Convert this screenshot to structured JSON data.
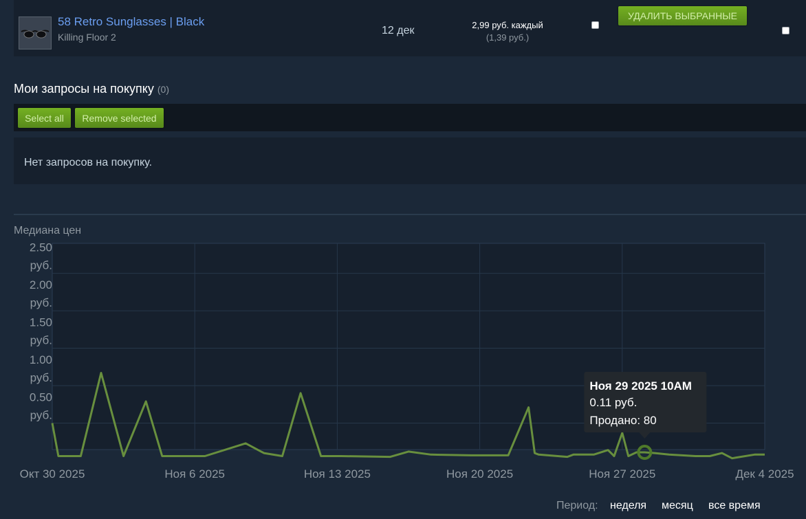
{
  "listing": {
    "item_name": "58 Retro Sunglasses | Black",
    "game": "Killing Floor 2",
    "date": "12 дек",
    "price": "2,99 руб. каждый",
    "price_sub": "(1,39 руб.)"
  },
  "buttons": {
    "remove_selected_ru": "УДАЛИТЬ ВЫБРАННЫЕ",
    "select_all": "Select all",
    "remove_selected": "Remove selected"
  },
  "buy_orders": {
    "title": "Мои запросы на покупку",
    "count": "(0)",
    "empty_text": "Нет запросов на покупку."
  },
  "colors": {
    "line": "#688f3e",
    "background": "#1b2838",
    "plot_background": "#16202d",
    "link": "#6b9ef0"
  },
  "chart_data": {
    "type": "line",
    "title": "Медиана цен",
    "ylim": [
      0,
      2.9
    ],
    "y_ticks": [
      {
        "value": 2.5,
        "line1": "2.50",
        "line2": "руб."
      },
      {
        "value": 2.0,
        "line1": "2.00",
        "line2": "руб."
      },
      {
        "value": 1.5,
        "line1": "1.50",
        "line2": "руб."
      },
      {
        "value": 1.0,
        "line1": "1.00",
        "line2": "руб."
      },
      {
        "value": 0.5,
        "line1": "0.50",
        "line2": "руб."
      }
    ],
    "x_ticks": [
      {
        "day": 0,
        "label": "Окт 30 2025"
      },
      {
        "day": 7,
        "label": "Ноя 6 2025"
      },
      {
        "day": 14,
        "label": "Ноя 13 2025"
      },
      {
        "day": 21,
        "label": "Ноя 20 2025"
      },
      {
        "day": 28,
        "label": "Ноя 27 2025"
      },
      {
        "day": 35,
        "label": "Дек 4 2025"
      }
    ],
    "grid": true,
    "series": [
      {
        "x": [
          0,
          0.3,
          1.4,
          2.4,
          3.5,
          4.6,
          5.4,
          6.2,
          7.5,
          9.5,
          10.4,
          11.3,
          12.2,
          13.2,
          14.2,
          16.6,
          17.5,
          18.6,
          20.6,
          21.3,
          22.4,
          23.4,
          23.7,
          23.9,
          25.3,
          25.6,
          26.6,
          27.3,
          27.6,
          28.0,
          28.3,
          28.7,
          29.1,
          29.6,
          30.3,
          31.6,
          32.3,
          32.9,
          33.4,
          33.6,
          34.5,
          34.8,
          35.0
        ],
        "y": [
          0.5,
          0.06,
          0.06,
          1.17,
          0.06,
          0.79,
          0.06,
          0.06,
          0.06,
          0.23,
          0.1,
          0.06,
          0.9,
          0.06,
          0.06,
          0.05,
          0.12,
          0.08,
          0.07,
          0.07,
          0.07,
          0.71,
          0.1,
          0.08,
          0.05,
          0.08,
          0.08,
          0.14,
          0.06,
          0.37,
          0.06,
          0.11,
          0.11,
          0.1,
          0.08,
          0.06,
          0.06,
          0.1,
          0.03,
          0.04,
          0.08,
          0.08,
          0.08
        ]
      }
    ],
    "highlight": {
      "x": 29.1,
      "y": 0.11
    },
    "tooltip": {
      "date": "Ноя 29 2025 10AM",
      "price": "0.11 руб.",
      "sold": "Продано: 80"
    }
  },
  "period": {
    "label": "Период:",
    "week": "неделя",
    "month": "месяц",
    "all": "все время"
  }
}
